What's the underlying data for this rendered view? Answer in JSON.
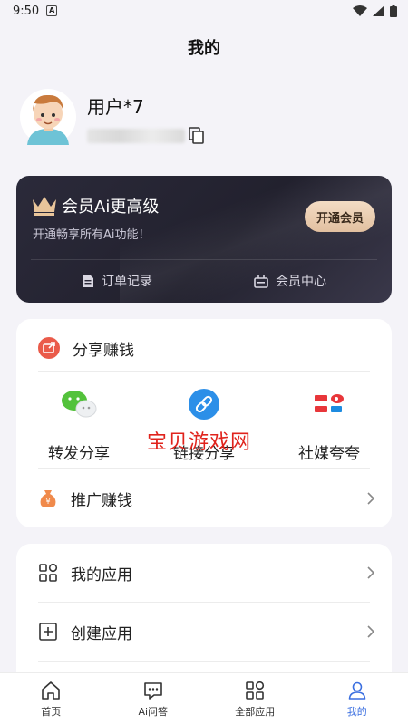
{
  "status_bar": {
    "time": "9:50"
  },
  "header": {
    "title": "我的"
  },
  "profile": {
    "username": "用户*7"
  },
  "vip": {
    "title": "会员Ai更高级",
    "subtitle": "开通畅享所有Ai功能！",
    "open_button": "开通会员",
    "links": [
      "订单记录",
      "会员中心"
    ]
  },
  "share_card": {
    "title": "分享赚钱",
    "options": [
      {
        "label": "转发分享",
        "icon": "wechat-icon"
      },
      {
        "label": "链接分享",
        "icon": "link-icon"
      },
      {
        "label": "社媒夸夸",
        "icon": "social-media-icon"
      }
    ],
    "promote": "推广赚钱"
  },
  "watermark": "宝贝游戏网",
  "apps_card": {
    "items": [
      "我的应用",
      "创建应用"
    ]
  },
  "tab_bar": {
    "tabs": [
      {
        "label": "首页",
        "icon": "home-icon",
        "active": false
      },
      {
        "label": "Ai问答",
        "icon": "chat-icon",
        "active": false
      },
      {
        "label": "全部应用",
        "icon": "apps-icon",
        "active": false
      },
      {
        "label": "我的",
        "icon": "user-icon",
        "active": true
      }
    ]
  },
  "colors": {
    "accent": "#3b6fe0",
    "vip_bg": "#22212e",
    "vip_button": "#e8c8a8",
    "share_red": "#ea5b4a"
  }
}
